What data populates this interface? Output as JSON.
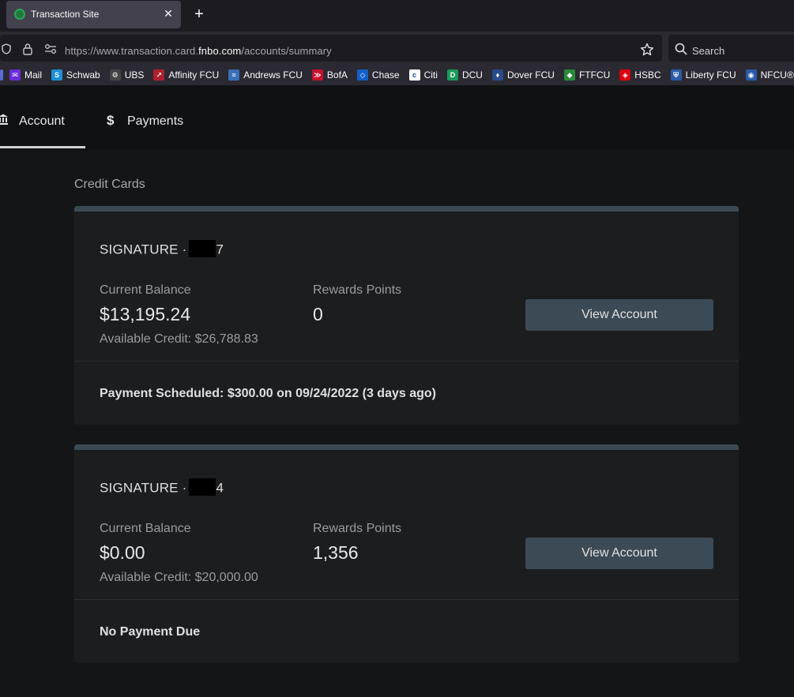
{
  "browser": {
    "tab_title": "Transaction Site",
    "url_prefix": "https://www.transaction.card.",
    "url_domain": "fnbo.com",
    "url_suffix": "/accounts/summary",
    "search_placeholder": "Search",
    "bookmarks": [
      {
        "label": "Mail",
        "icon": "mail-icon",
        "color": "#6a2bd8",
        "glyph": "✉"
      },
      {
        "label": "Schwab",
        "icon": "schwab-icon",
        "color": "#1d8fd8",
        "glyph": "S"
      },
      {
        "label": "UBS",
        "icon": "ubs-icon",
        "color": "#444444",
        "glyph": "⚙"
      },
      {
        "label": "Affinity FCU",
        "icon": "affinity-icon",
        "color": "#b0202e",
        "glyph": "↗"
      },
      {
        "label": "Andrews FCU",
        "icon": "andrews-icon",
        "color": "#3a6fb8",
        "glyph": "≈"
      },
      {
        "label": "BofA",
        "icon": "bofa-icon",
        "color": "#c8102e",
        "glyph": "≫"
      },
      {
        "label": "Chase",
        "icon": "chase-icon",
        "color": "#1160c8",
        "glyph": "◇"
      },
      {
        "label": "Citi",
        "icon": "citi-icon",
        "color": "#ffffff",
        "glyph": "c"
      },
      {
        "label": "DCU",
        "icon": "dcu-icon",
        "color": "#1a9a5a",
        "glyph": "D"
      },
      {
        "label": "Dover FCU",
        "icon": "dover-icon",
        "color": "#2a4a8a",
        "glyph": "♦"
      },
      {
        "label": "FTFCU",
        "icon": "ftfcu-icon",
        "color": "#2a8a3a",
        "glyph": "◆"
      },
      {
        "label": "HSBC",
        "icon": "hsbc-icon",
        "color": "#db0011",
        "glyph": "◈"
      },
      {
        "label": "Liberty FCU",
        "icon": "liberty-icon",
        "color": "#2a5aa8",
        "glyph": "⛨"
      },
      {
        "label": "NFCU®",
        "icon": "nfcu-icon",
        "color": "#2a5aa8",
        "glyph": "◉"
      }
    ]
  },
  "nav": {
    "account_label": "Account",
    "payments_label": "Payments",
    "payments_glyph": "$"
  },
  "section_title": "Credit Cards",
  "cards": [
    {
      "name_prefix": "SIGNATURE ·",
      "name_suffix": "7",
      "balance_label": "Current Balance",
      "balance": "$13,195.24",
      "available_credit": "Available Credit: $26,788.83",
      "rewards_label": "Rewards Points",
      "rewards": "0",
      "button_label": "View Account",
      "footer": "Payment Scheduled: $300.00 on 09/24/2022 (3 days ago)"
    },
    {
      "name_prefix": "SIGNATURE ·",
      "name_suffix": "4",
      "balance_label": "Current Balance",
      "balance": "$0.00",
      "available_credit": "Available Credit: $20,000.00",
      "rewards_label": "Rewards Points",
      "rewards": "1,356",
      "button_label": "View Account",
      "footer": "No Payment Due"
    }
  ]
}
